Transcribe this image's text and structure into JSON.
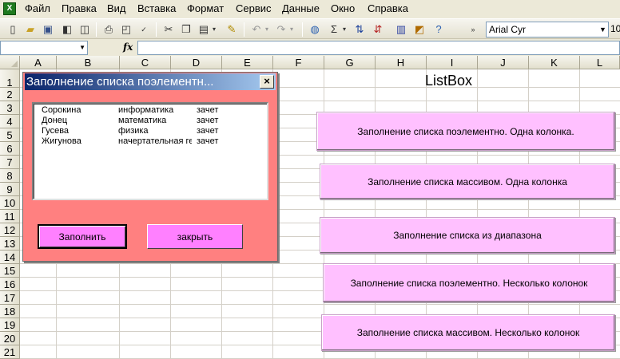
{
  "app": {
    "icon": "excel-app-icon",
    "icon_glyph": "X"
  },
  "menu": [
    "Файл",
    "Правка",
    "Вид",
    "Вставка",
    "Формат",
    "Сервис",
    "Данные",
    "Окно",
    "Справка"
  ],
  "toolbar": {
    "font_name": "Arial Cyr",
    "font_size": "10",
    "sum_glyph": "Σ",
    "icons": [
      "new-icon",
      "open-icon",
      "save-icon",
      "permission-icon",
      "print-preview-icon",
      "print-icon",
      "spelling-icon",
      "cut-icon",
      "copy-icon",
      "paste-icon",
      "format-painter-icon",
      "undo-icon",
      "redo-icon",
      "hyperlink-icon",
      "autosum-icon",
      "sort-ascending-icon",
      "sort-descending-icon",
      "chart-wizard-icon",
      "drawing-icon",
      "help-icon"
    ]
  },
  "formula_bar": {
    "name_box": "",
    "fx_label": "fx",
    "formula": ""
  },
  "sheet": {
    "columns": [
      "A",
      "B",
      "C",
      "D",
      "E",
      "F",
      "G",
      "H",
      "I",
      "J",
      "K",
      "L"
    ],
    "rows": [
      "1",
      "2",
      "3",
      "4",
      "5",
      "6",
      "7",
      "8",
      "9",
      "10",
      "11",
      "12",
      "13",
      "14",
      "15",
      "16",
      "17",
      "18",
      "19",
      "20",
      "21"
    ],
    "title": "ListBox",
    "buttons": [
      "Заполнение списка поэлементно. Одна колонка.",
      "Заполнение списка массивом. Одна колонка",
      "Заполнение списка из диапазона",
      "Заполнение списка поэлементно. Несколько колонок",
      "Заполнение списка массивом. Несколько колонок"
    ]
  },
  "dialog": {
    "title": "Заполнение списка поэлементн...",
    "close_glyph": "×",
    "list": [
      [
        "Сорокина",
        "информатика",
        "зачет"
      ],
      [
        "Донец",
        "математика",
        "зачет"
      ],
      [
        "Гусева",
        "физика",
        "зачет"
      ],
      [
        "Жигунова",
        "начертательная геометрия",
        "зачет"
      ]
    ],
    "fill_button": "Заполнить",
    "close_button": "закрыть"
  },
  "colors": {
    "dialog_bg": "#ff8080",
    "dialog_button": "#ff80ff",
    "sheet_button": "#ffc0ff",
    "titlebar": "#0a246a"
  }
}
